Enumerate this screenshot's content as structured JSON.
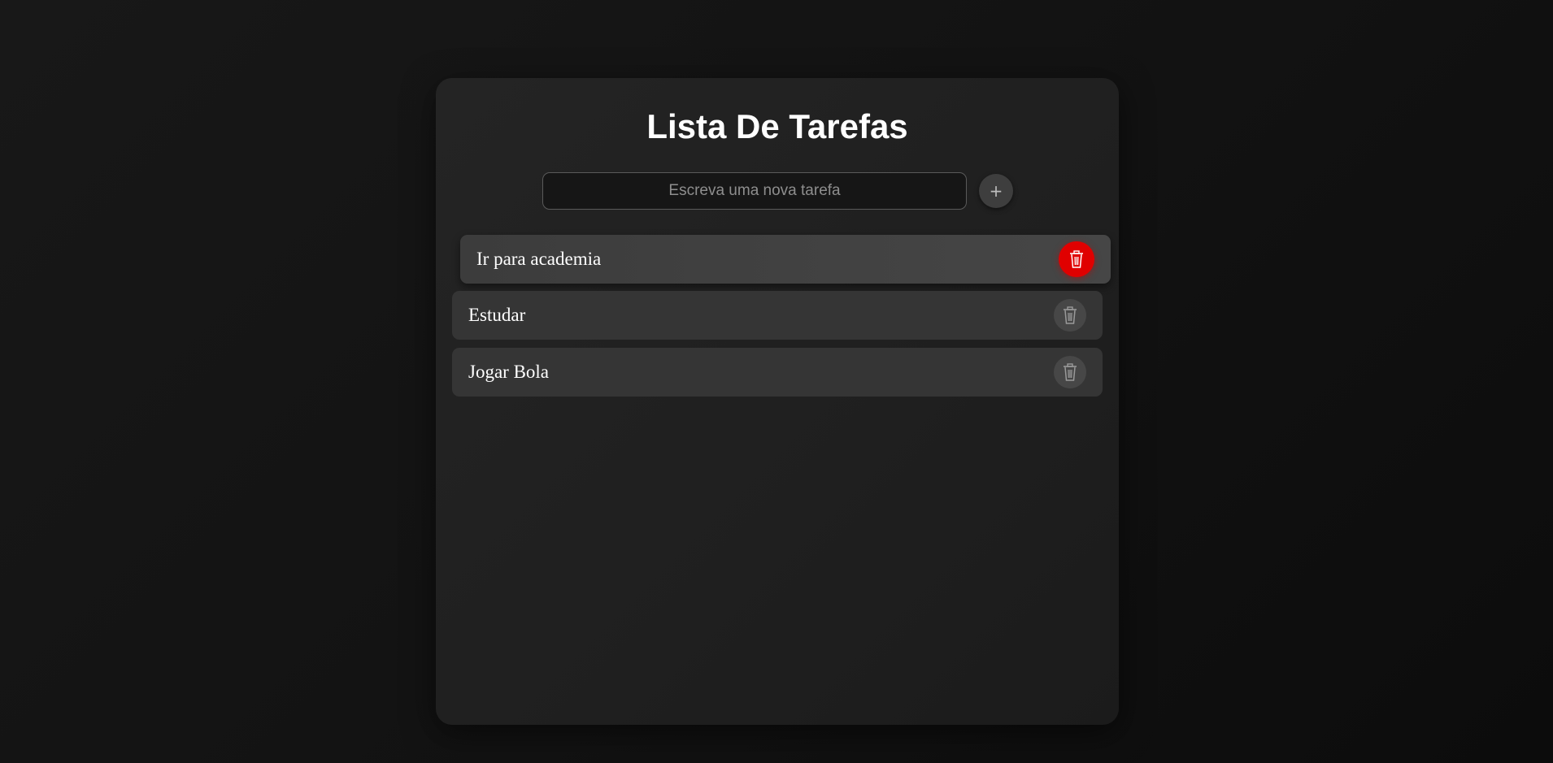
{
  "app": {
    "title": "Lista De Tarefas"
  },
  "new_task": {
    "placeholder": "Escreva uma nova tarefa",
    "value": "",
    "add_label": "+"
  },
  "tasks": [
    {
      "label": "Ir para academia",
      "state": "hovered"
    },
    {
      "label": "Estudar",
      "state": "normal"
    },
    {
      "label": "Jogar Bola",
      "state": "normal"
    }
  ],
  "icons": {
    "delete": "trash-icon",
    "add": "plus-icon"
  },
  "colors": {
    "delete_active": "#e00000",
    "delete_idle": "#474747"
  }
}
